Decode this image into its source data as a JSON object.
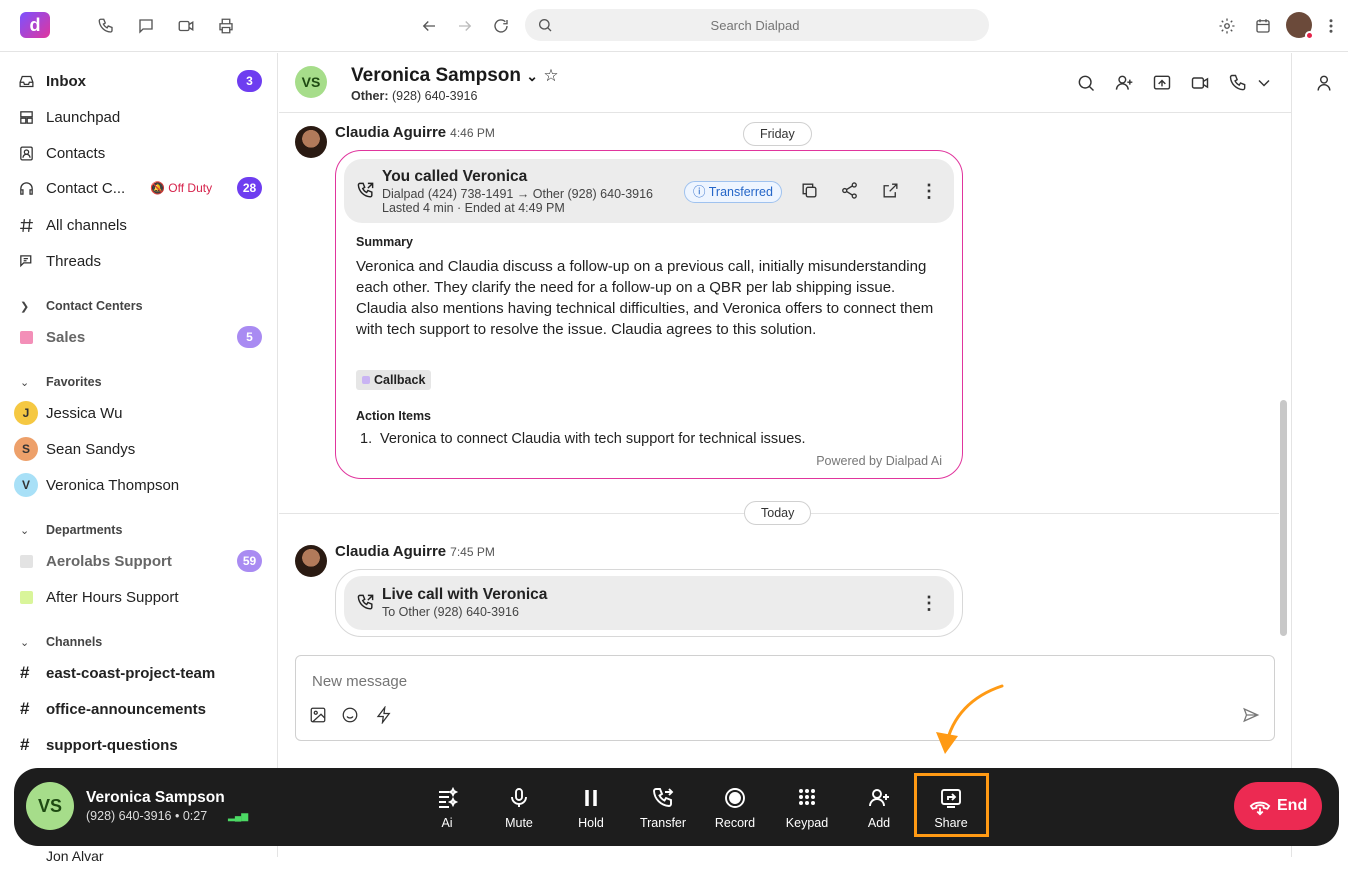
{
  "top_bar": {
    "logo_letter": "d",
    "search_placeholder": "Search Dialpad",
    "icons": [
      "phone-icon",
      "chat-icon",
      "video-icon",
      "print-icon",
      "back-icon",
      "forward-icon",
      "refresh-icon",
      "settings-icon",
      "calendar-icon",
      "more-icon"
    ]
  },
  "sidebar": {
    "nav": [
      {
        "label": "Inbox",
        "badge": "3",
        "icon": "inbox-icon"
      },
      {
        "label": "Launchpad",
        "icon": "launchpad-icon"
      },
      {
        "label": "Contacts",
        "icon": "contacts-icon"
      },
      {
        "label": "Contact C...",
        "status": "Off Duty",
        "badge": "28",
        "icon": "headset-icon"
      },
      {
        "label": "All channels",
        "icon": "hash-icon"
      },
      {
        "label": "Threads",
        "icon": "threads-icon"
      }
    ],
    "contact_centers": {
      "title": "Contact Centers",
      "items": [
        {
          "label": "Sales",
          "badge": "5",
          "color": "#f38fb8"
        }
      ]
    },
    "favorites": {
      "title": "Favorites",
      "items": [
        {
          "label": "Jessica Wu",
          "initial": "J",
          "color": "#f5c842"
        },
        {
          "label": "Sean Sandys",
          "initial": "S",
          "color": "#eda06a"
        },
        {
          "label": "Veronica Thompson",
          "initial": "V",
          "color": "#a8e0f7"
        }
      ]
    },
    "departments": {
      "title": "Departments",
      "items": [
        {
          "label": "Aerolabs Support",
          "badge": "59",
          "color": "#e3e3e3"
        },
        {
          "label": "After Hours Support",
          "color": "#d9f59a"
        }
      ]
    },
    "channels": {
      "title": "Channels",
      "items": [
        "east-coast-project-team",
        "office-announcements",
        "support-questions"
      ]
    },
    "partial_item": "Jon Alvar"
  },
  "conversation": {
    "header": {
      "initials": "VS",
      "name": "Veronica Sampson",
      "sub_label": "Other:",
      "sub_number": "(928) 640-3916"
    },
    "day1": "Friday",
    "msg1": {
      "sender": "Claudia Aguirre",
      "time": "4:46 PM",
      "call_title": "You called Veronica",
      "call_route": "Dialpad (424) 738-1491 → Other (928) 640-3916",
      "call_meta": "Lasted 4 min · Ended at 4:49 PM",
      "status": "Transferred",
      "summary_heading": "Summary",
      "summary": "Veronica and Claudia discuss a follow-up on a previous call, initially misunderstanding each other. They clarify the need for a follow-up on a QBR per lab shipping issue. Claudia also mentions having technical difficulties, and Veronica offers to connect them with tech support to resolve the issue. Claudia agrees to this solution.",
      "tag": "Callback",
      "action_heading": "Action Items",
      "action_num": "1.",
      "action_item": "Veronica to connect Claudia with tech support for technical issues.",
      "powered_by": "Powered by Dialpad Ai"
    },
    "day2": "Today",
    "msg2": {
      "sender": "Claudia Aguirre",
      "time": "7:45 PM",
      "call_title": "Live call with Veronica",
      "call_sub": "To Other (928) 640-3916"
    },
    "composer_placeholder": "New message"
  },
  "call_bar": {
    "initials": "VS",
    "name": "Veronica Sampson",
    "number": "(928) 640-3916",
    "duration": "• 0:27",
    "controls": [
      "Ai",
      "Mute",
      "Hold",
      "Transfer",
      "Record",
      "Keypad",
      "Add",
      "Share"
    ],
    "highlighted_control": "Share",
    "highlight_color": "#ff9a14",
    "end_label": "End"
  }
}
